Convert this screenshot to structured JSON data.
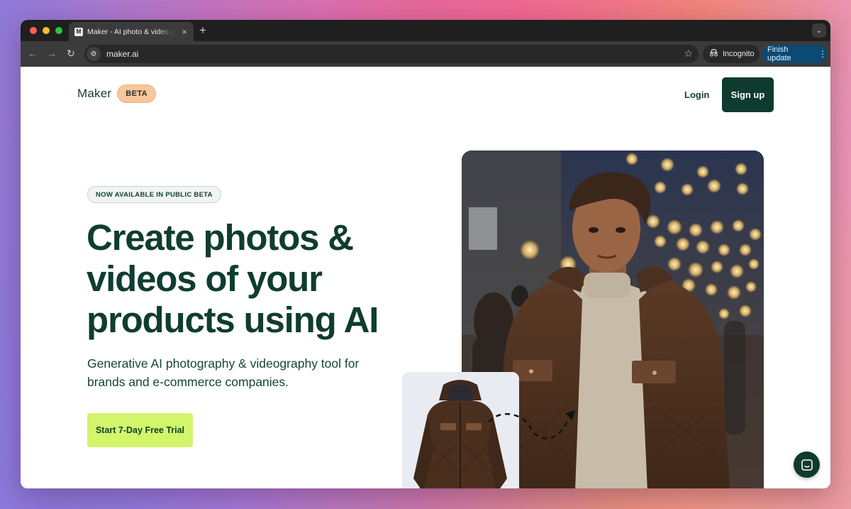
{
  "browser": {
    "tab_title": "Maker - AI photo & video generator",
    "tab_favicon": "M",
    "tab_close": "×",
    "new_tab": "+",
    "url": "maker.ai",
    "incognito_label": "Incognito",
    "update_label": "Finish update",
    "icons": [
      "back-icon",
      "forward-icon",
      "reload-icon",
      "site-info-icon",
      "star-icon",
      "incognito-icon",
      "kebab-icon",
      "tab-search-icon"
    ]
  },
  "nav": {
    "logo": "Maker",
    "badge": "BETA",
    "login": "Login",
    "signup": "Sign up"
  },
  "hero": {
    "pill": "NOW AVAILABLE IN PUBLIC BETA",
    "headline": "Create photos & videos of your products using AI",
    "subhead": "Generative AI photography & videography tool for brands and e-commerce companies.",
    "cta": "Start 7-Day Free Trial"
  },
  "colors": {
    "brand_dark": "#0e3b2d",
    "cta_green": "#d3f56b",
    "beta_orange": "#f8c69b",
    "update_blue": "#0b4a75"
  }
}
